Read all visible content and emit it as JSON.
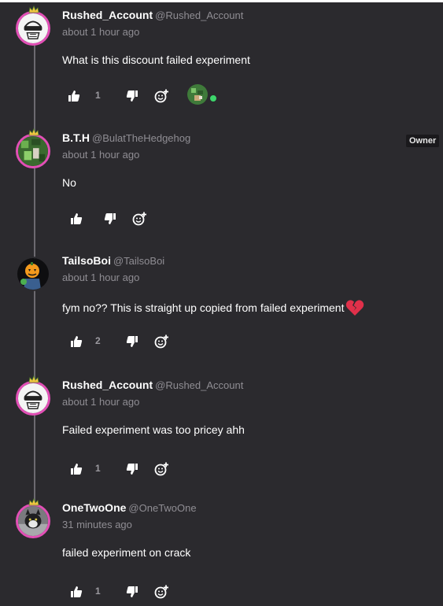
{
  "comments": [
    {
      "display_name": "Rushed_Account",
      "handle": "@Rushed_Account",
      "time": "about 1 hour ago",
      "text": "What is this discount failed experiment",
      "like_count": "1",
      "avatar": "sketch-avatar",
      "has_reaction": true
    },
    {
      "display_name": "B.T.H",
      "handle": "@BulatTheHedgehog",
      "time": "about 1 hour ago",
      "text": "No",
      "like_count": "",
      "avatar": "green-pixel-avatar",
      "badge": "Owner"
    },
    {
      "display_name": "TailsoBoi",
      "handle": "@TailsoBoi",
      "time": "about 1 hour ago",
      "text": "fym no?? This is straight up copied from failed experiment",
      "emoji": "broken-heart-icon",
      "like_count": "2",
      "avatar": "pumpkin-avatar"
    },
    {
      "display_name": "Rushed_Account",
      "handle": "@Rushed_Account",
      "time": "about 1 hour ago",
      "text": "Failed experiment was too pricey ahh",
      "like_count": "1",
      "avatar": "sketch-avatar"
    },
    {
      "display_name": "OneTwoOne",
      "handle": "@OneTwoOne",
      "time": "31 minutes ago",
      "text": "failed experiment on crack",
      "like_count": "1",
      "avatar": "cat-photo-avatar"
    }
  ],
  "icons": {
    "like": "thumbs-up-icon",
    "dislike": "thumbs-down-icon",
    "react": "add-reaction-icon",
    "crown": "crown-icon"
  },
  "colors": {
    "background": "#2b2a2e",
    "avatar_ring": "#e24fb6",
    "thread_line": "#6c6a70",
    "muted_text": "#8f8d93",
    "reaction_online": "#3dd66b",
    "heart": "#e0304a"
  }
}
